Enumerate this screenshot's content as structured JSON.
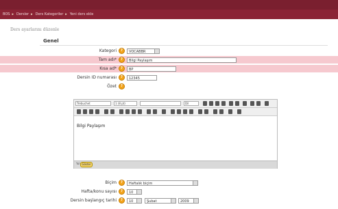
{
  "page": {
    "title": "Ders ayarlarını düzenle"
  },
  "nav": {
    "items": [
      "BOS",
      "Dersler",
      "Ders Kategoriler",
      "Yeni ders ekle"
    ]
  },
  "form": {
    "legend": "Genel",
    "fields": {
      "kategori": {
        "label": "Kategori",
        "value": "VOCABBR"
      },
      "tam_ad": {
        "label": "Tam adı*",
        "value": "Bilgi Paylaşım"
      },
      "kisa_ad": {
        "label": "Kısa ad*",
        "value": "BP"
      },
      "idnum": {
        "label": "Dersin ID numarası",
        "value": "12345"
      },
      "ozet": {
        "label": "Özet"
      },
      "bicim": {
        "label": "Biçim",
        "value": "Haftalık biçim"
      },
      "hafta_sayisi": {
        "label": "Hafta/konu sayısı",
        "value": "10"
      },
      "baslangic": {
        "label": "Dersin başlangıç tarihi",
        "day": "10",
        "month": "Şubat",
        "year": "2009"
      }
    }
  },
  "editor": {
    "font": "Trebuchet",
    "size": "1 (8 pt)",
    "lang": "Dil",
    "content": "Bilgi Paylaşım",
    "path": "Yol: body",
    "toggle": "Göster"
  },
  "colors": {
    "brand": "#8b2335",
    "required_row": "#f6c9cf",
    "help_icon": "#f3a41b"
  }
}
